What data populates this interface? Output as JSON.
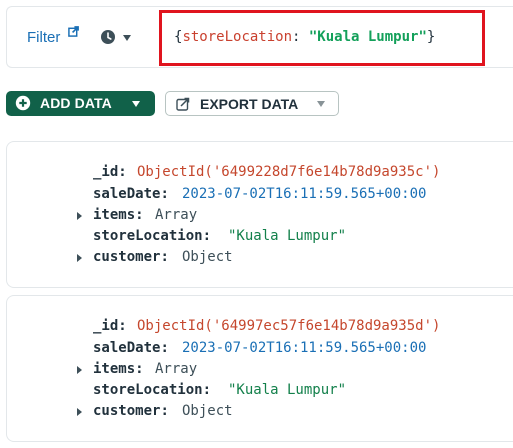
{
  "filter": {
    "label": "Filter",
    "query": {
      "open_brace": "{",
      "key": "storeLocation",
      "colon": ": ",
      "value": "\"Kuala Lumpur\"",
      "close_brace": "}"
    }
  },
  "toolbar": {
    "add_label": "ADD DATA",
    "export_label": "EXPORT DATA"
  },
  "documents": [
    {
      "id_key": "_id",
      "id_value": "ObjectId('6499228d7f6e14b78d9a935c')",
      "saleDate_key": "saleDate",
      "saleDate_value": "2023-07-02T16:11:59.565+00:00",
      "items_key": "items",
      "items_value": "Array",
      "storeLocation_key": "storeLocation",
      "storeLocation_value": "\"Kuala Lumpur\"",
      "customer_key": "customer",
      "customer_value": "Object"
    },
    {
      "id_key": "_id",
      "id_value": "ObjectId('64997ec57f6e14b78d9a935d')",
      "saleDate_key": "saleDate",
      "saleDate_value": "2023-07-02T16:11:59.565+00:00",
      "items_key": "items",
      "items_value": "Array",
      "storeLocation_key": "storeLocation",
      "storeLocation_value": "\"Kuala Lumpur\"",
      "customer_key": "customer",
      "customer_value": "Object"
    }
  ],
  "colors": {
    "add_button": "#116149",
    "highlight_border": "#e0141e",
    "link_blue": "#1a6fb5"
  },
  "icons": {
    "external_link": "external-link-icon",
    "history": "clock-icon",
    "add": "plus-circle-icon",
    "export": "export-icon",
    "expand": "caret-right-icon"
  }
}
